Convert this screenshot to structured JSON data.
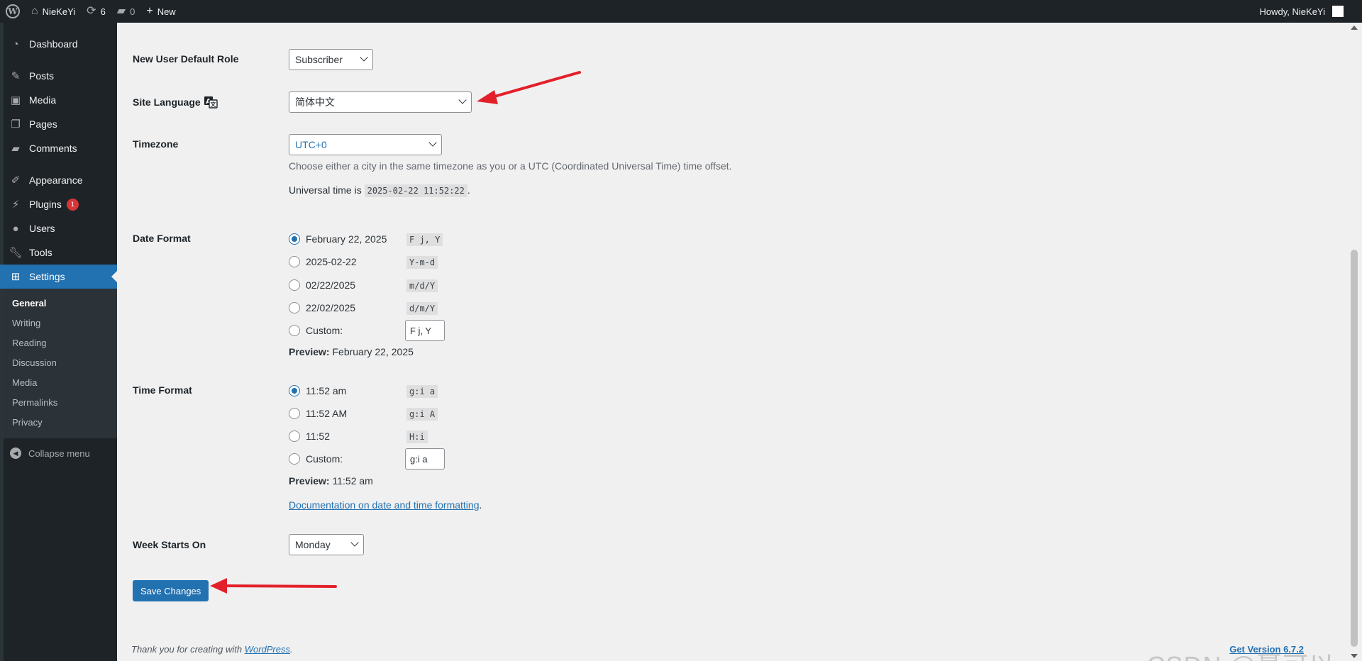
{
  "adminbar": {
    "site_name": "NieKeYi",
    "updates_count": "6",
    "comments_count": "0",
    "new_label": "New",
    "howdy": "Howdy, NieKeYi"
  },
  "sidebar": {
    "items": [
      {
        "label": "Dashboard",
        "icon": "dashboard-icon"
      },
      {
        "label": "Posts",
        "icon": "pin-icon"
      },
      {
        "label": "Media",
        "icon": "media-icon"
      },
      {
        "label": "Pages",
        "icon": "pages-icon"
      },
      {
        "label": "Comments",
        "icon": "comment-icon"
      },
      {
        "label": "Appearance",
        "icon": "brush-icon"
      },
      {
        "label": "Plugins",
        "icon": "plugin-icon",
        "badge": "1"
      },
      {
        "label": "Users",
        "icon": "user-icon"
      },
      {
        "label": "Tools",
        "icon": "wrench-icon"
      },
      {
        "label": "Settings",
        "icon": "settings-icon"
      }
    ],
    "submenu": [
      "General",
      "Writing",
      "Reading",
      "Discussion",
      "Media",
      "Permalinks",
      "Privacy"
    ],
    "collapse_label": "Collapse menu"
  },
  "form": {
    "default_role": {
      "label": "New User Default Role",
      "value": "Subscriber"
    },
    "site_language": {
      "label": "Site Language",
      "value": "简体中文"
    },
    "timezone": {
      "label": "Timezone",
      "value": "UTC+0",
      "description": "Choose either a city in the same timezone as you or a UTC (Coordinated Universal Time) time offset.",
      "universal_prefix": "Universal time is",
      "universal_time": "2025-02-22 11:52:22",
      "universal_suffix": "."
    },
    "date_format": {
      "label": "Date Format",
      "options": [
        {
          "label": "February 22, 2025",
          "code": "F j, Y",
          "checked": true
        },
        {
          "label": "2025-02-22",
          "code": "Y-m-d",
          "checked": false
        },
        {
          "label": "02/22/2025",
          "code": "m/d/Y",
          "checked": false
        },
        {
          "label": "22/02/2025",
          "code": "d/m/Y",
          "checked": false
        }
      ],
      "custom_label": "Custom:",
      "custom_value": "F j, Y",
      "preview_label": "Preview:",
      "preview_value": "February 22, 2025"
    },
    "time_format": {
      "label": "Time Format",
      "options": [
        {
          "label": "11:52 am",
          "code": "g:i a",
          "checked": true
        },
        {
          "label": "11:52 AM",
          "code": "g:i A",
          "checked": false
        },
        {
          "label": "11:52",
          "code": "H:i",
          "checked": false
        }
      ],
      "custom_label": "Custom:",
      "custom_value": "g:i a",
      "preview_label": "Preview:",
      "preview_value": "11:52 am",
      "doc_link": "Documentation on date and time formatting",
      "doc_suffix": "."
    },
    "week_starts": {
      "label": "Week Starts On",
      "value": "Monday"
    },
    "save_label": "Save Changes"
  },
  "footer": {
    "thanks_prefix": "Thank you for creating with",
    "thanks_link": "WordPress",
    "thanks_suffix": ".",
    "version": "Get Version 6.7.2"
  },
  "watermark": "CSDN @聂可以",
  "colors": {
    "accent": "#2271b1",
    "adminbar": "#1d2327",
    "annotation_arrow": "#e3202a",
    "badge": "#d63638"
  }
}
